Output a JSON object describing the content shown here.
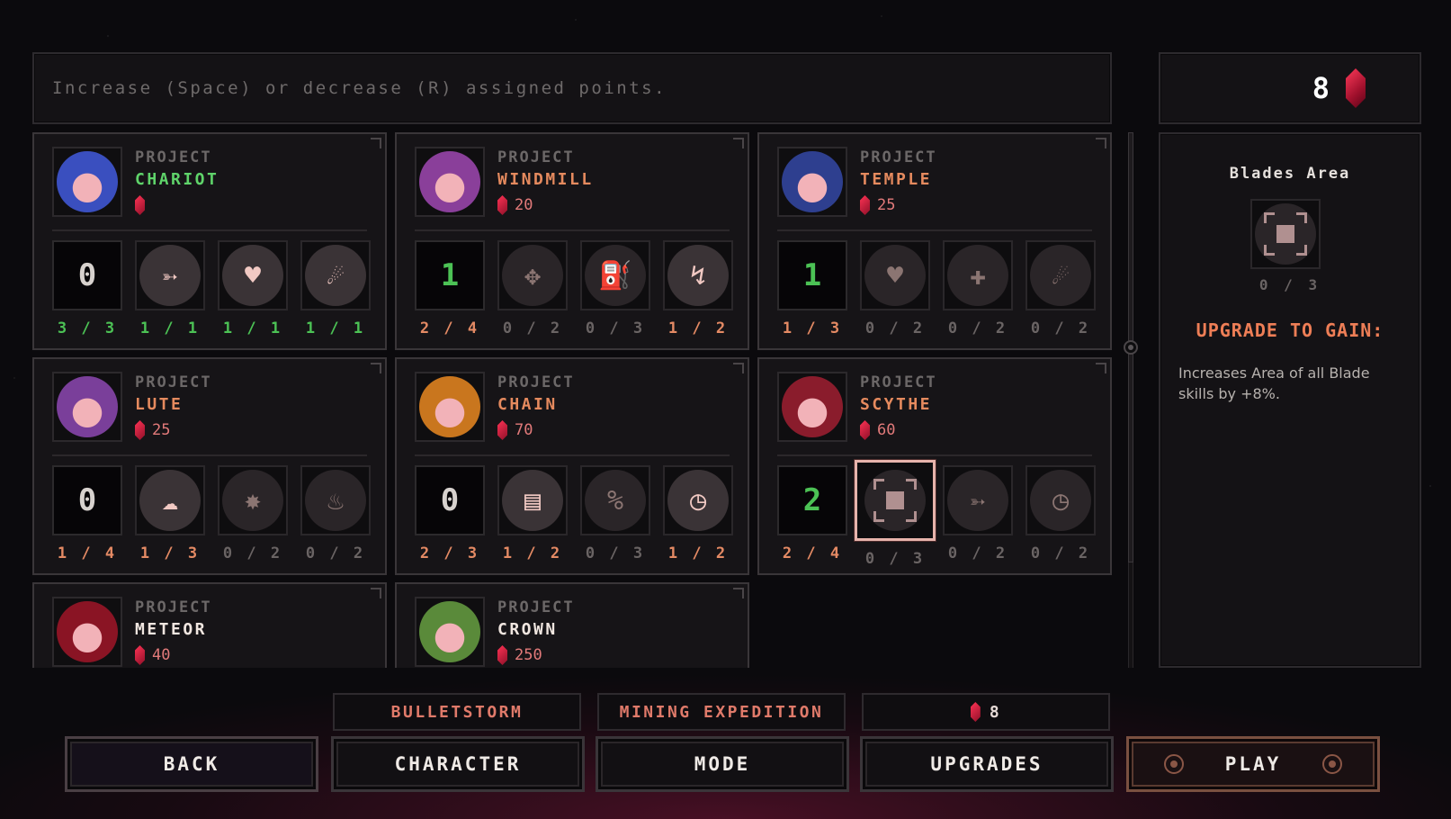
{
  "instruction": "Increase (Space) or decrease (R) assigned points.",
  "gems_total": "8",
  "projects": [
    {
      "proj": "PROJECT",
      "name": "CHARIOT",
      "name_color": "#5fd36a",
      "cost": "",
      "disc_color": "#3a4fbf",
      "level": "0",
      "level_green": false,
      "slots": [
        {
          "icon": "bullet-icon",
          "glyph": "➳",
          "count": "1 / 1",
          "tone": "green",
          "lit": true
        },
        {
          "icon": "heart-icon",
          "glyph": "♥",
          "count": "1 / 1",
          "tone": "green",
          "lit": true
        },
        {
          "icon": "speed-icon",
          "glyph": "☄",
          "count": "1 / 1",
          "tone": "green",
          "lit": true
        }
      ],
      "level_count": "3 / 3",
      "level_tone": "green"
    },
    {
      "proj": "PROJECT",
      "name": "WINDMILL",
      "name_color": "#e58a5e",
      "cost": "20",
      "disc_color": "#8a3f9a",
      "level": "1",
      "level_green": true,
      "slots": [
        {
          "icon": "move-icon",
          "glyph": "✥",
          "count": "0 / 2",
          "tone": "grey",
          "lit": false
        },
        {
          "icon": "fuel-icon",
          "glyph": "⛽",
          "count": "0 / 3",
          "tone": "grey",
          "lit": false
        },
        {
          "icon": "bolt-icon",
          "glyph": "↯",
          "count": "1 / 2",
          "tone": "orange",
          "lit": true
        }
      ],
      "level_count": "2 / 4",
      "level_tone": "orange"
    },
    {
      "proj": "PROJECT",
      "name": "TEMPLE",
      "name_color": "#e58a5e",
      "cost": "25",
      "disc_color": "#2e3f8f",
      "level": "1",
      "level_green": true,
      "slots": [
        {
          "icon": "heart-icon",
          "glyph": "♥",
          "count": "0 / 2",
          "tone": "grey",
          "lit": false
        },
        {
          "icon": "medkit-icon",
          "glyph": "✚",
          "count": "0 / 2",
          "tone": "grey",
          "lit": false
        },
        {
          "icon": "speed-icon",
          "glyph": "☄",
          "count": "0 / 2",
          "tone": "grey",
          "lit": false
        }
      ],
      "level_count": "1 / 3",
      "level_tone": "orange"
    },
    {
      "proj": "PROJECT",
      "name": "LUTE",
      "name_color": "#e58a5e",
      "cost": "25",
      "disc_color": "#7a3f9a",
      "level": "0",
      "level_green": false,
      "slots": [
        {
          "icon": "dash-icon",
          "glyph": "☁",
          "count": "1 / 3",
          "tone": "orange",
          "lit": true
        },
        {
          "icon": "explosion-icon",
          "glyph": "✸",
          "count": "0 / 2",
          "tone": "grey",
          "lit": false
        },
        {
          "icon": "flame-icon",
          "glyph": "♨",
          "count": "0 / 2",
          "tone": "grey",
          "lit": false
        }
      ],
      "level_count": "1 / 4",
      "level_tone": "orange"
    },
    {
      "proj": "PROJECT",
      "name": "CHAIN",
      "name_color": "#e58a5e",
      "cost": "70",
      "disc_color": "#c9761e",
      "level": "0",
      "level_green": false,
      "slots": [
        {
          "icon": "ammo-icon",
          "glyph": "▤",
          "count": "1 / 2",
          "tone": "orange",
          "lit": true
        },
        {
          "icon": "rate-of-fire-icon",
          "glyph": "%",
          "count": "0 / 3",
          "tone": "grey",
          "lit": false
        },
        {
          "icon": "reload-icon",
          "glyph": "◷",
          "count": "1 / 2",
          "tone": "orange",
          "lit": true
        }
      ],
      "level_count": "2 / 3",
      "level_tone": "orange"
    },
    {
      "proj": "PROJECT",
      "name": "SCYTHE",
      "name_color": "#e58a5e",
      "cost": "60",
      "disc_color": "#8a1c2c",
      "level": "2",
      "level_green": true,
      "slots": [
        {
          "icon": "blades-area-icon",
          "glyph": "",
          "count": "0 / 3",
          "tone": "grey",
          "lit": false,
          "selected": true
        },
        {
          "icon": "blade-damage-icon",
          "glyph": "➳",
          "count": "0 / 2",
          "tone": "grey",
          "lit": false
        },
        {
          "icon": "blade-cooldown-icon",
          "glyph": "◷",
          "count": "0 / 2",
          "tone": "grey",
          "lit": false
        }
      ],
      "level_count": "2 / 4",
      "level_tone": "orange"
    },
    {
      "proj": "PROJECT",
      "name": "METEOR",
      "name_color": "#f0e6e0",
      "cost": "40",
      "disc_color": "#8a1424"
    },
    {
      "proj": "PROJECT",
      "name": "CROWN",
      "name_color": "#f0e6e0",
      "cost": "250",
      "disc_color": "#5a8a3a"
    }
  ],
  "detail": {
    "title": "Blades Area",
    "icon": "blades-area-icon",
    "progress": "0 / 3",
    "upgrade_title": "UPGRADE TO GAIN:",
    "description": "Increases Area of all Blade skills by +8%."
  },
  "info_tabs": {
    "character": "BULLETSTORM",
    "mode": "MINING EXPEDITION",
    "gems": "8"
  },
  "buttons": {
    "back": "BACK",
    "character": "CHARACTER",
    "mode": "MODE",
    "upgrades": "UPGRADES",
    "play": "PLAY"
  },
  "colors": {
    "accent_orange": "#ee7e56",
    "green": "#4cc255",
    "gem_red": "#e0203f"
  }
}
